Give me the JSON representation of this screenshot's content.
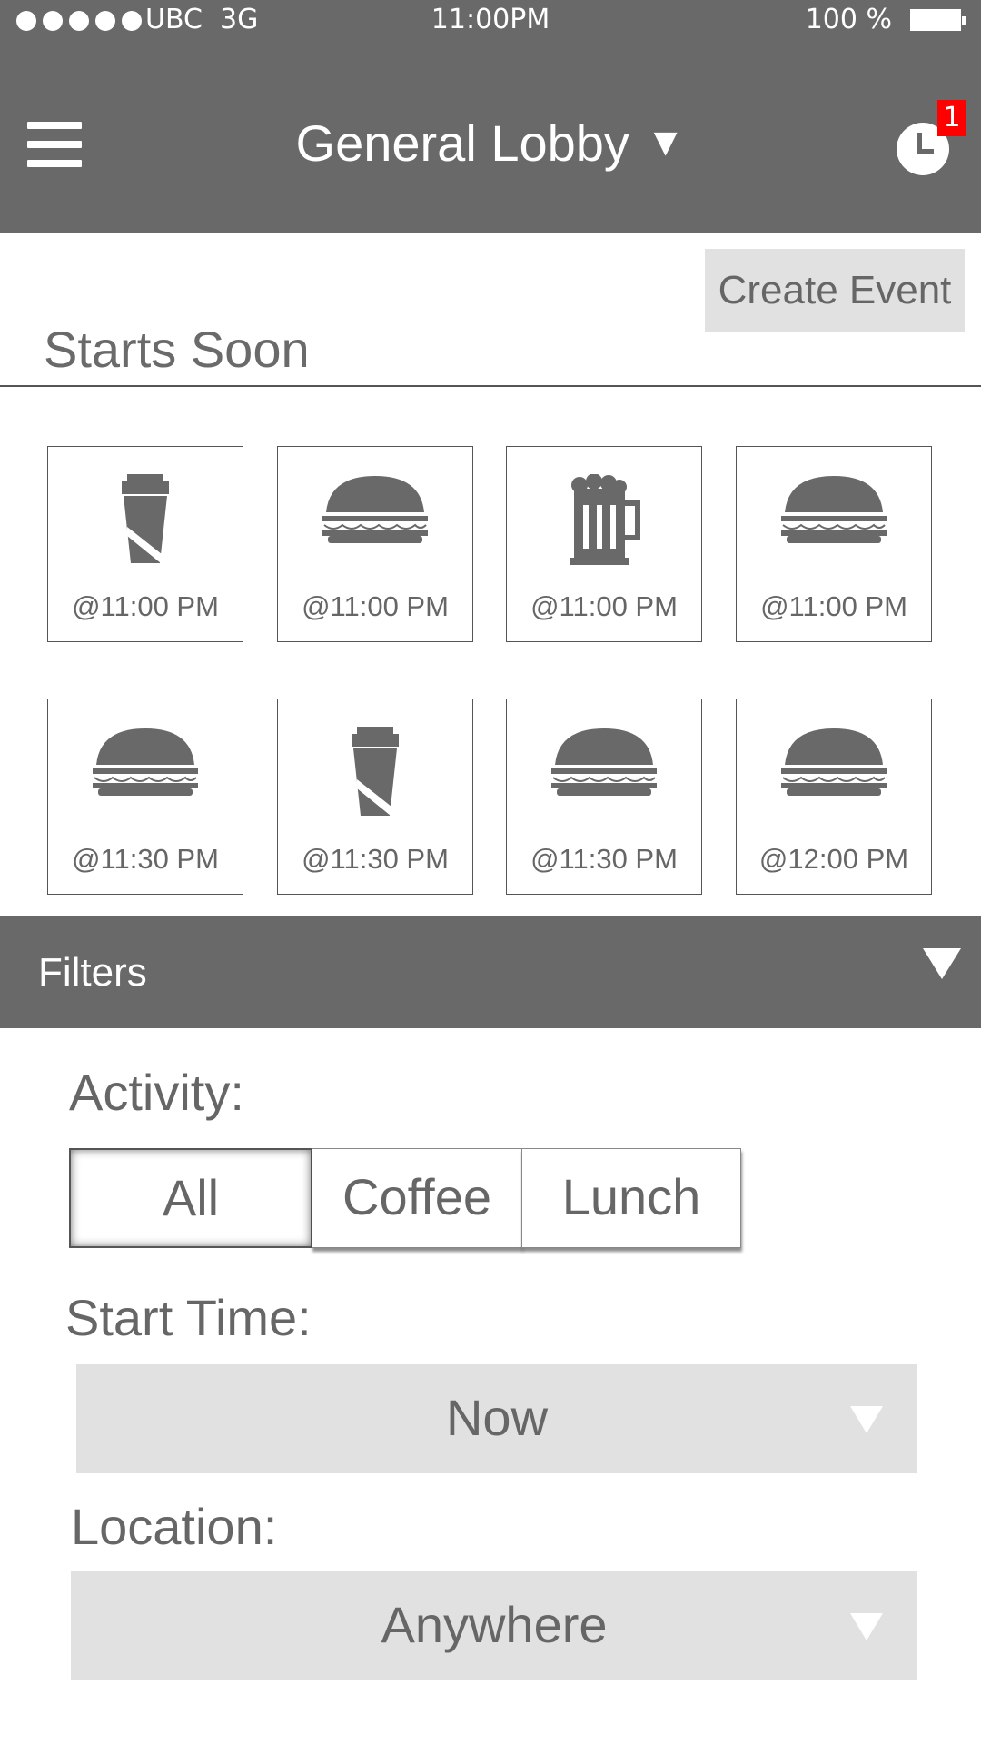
{
  "status_bar": {
    "carrier": "UBC",
    "network": "3G",
    "time": "11:00PM",
    "battery": "100 %"
  },
  "header": {
    "title": "General Lobby",
    "caret": "▼",
    "notification_count": "1",
    "menu_icon": "hamburger-icon",
    "history_icon": "clock-icon"
  },
  "create_event_label": "Create Event",
  "starts_soon": {
    "title": "Starts Soon",
    "events": [
      {
        "icon": "coffee",
        "time": "@11:00 PM"
      },
      {
        "icon": "burger",
        "time": "@11:00 PM"
      },
      {
        "icon": "beer",
        "time": "@11:00 PM"
      },
      {
        "icon": "burger",
        "time": "@11:00 PM"
      },
      {
        "icon": "burger",
        "time": "@11:30 PM"
      },
      {
        "icon": "coffee",
        "time": "@11:30 PM"
      },
      {
        "icon": "burger",
        "time": "@11:30 PM"
      },
      {
        "icon": "burger",
        "time": "@12:00 PM"
      }
    ]
  },
  "filters": {
    "title": "Filters",
    "activity": {
      "label": "Activity:",
      "options": [
        "All",
        "Coffee",
        "Lunch"
      ],
      "selected": "All"
    },
    "start_time": {
      "label": "Start Time:",
      "value": "Now"
    },
    "location": {
      "label": "Location:",
      "value": "Anywhere"
    }
  },
  "colors": {
    "header_bg": "#696969",
    "button_bg": "#e1e1e1",
    "badge": "#ff0000",
    "text": "#666666"
  }
}
